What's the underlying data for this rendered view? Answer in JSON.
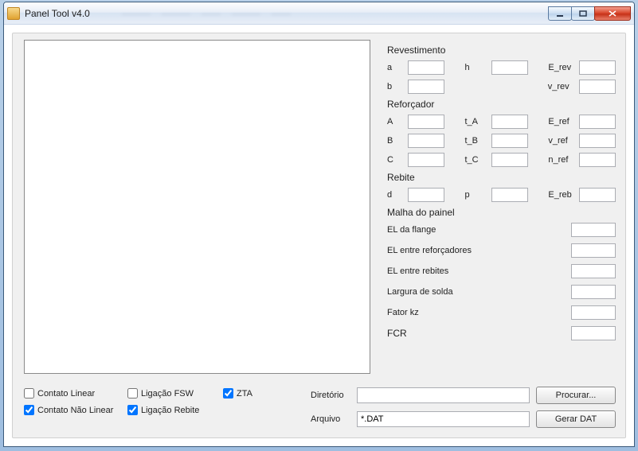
{
  "window": {
    "title": "Panel Tool v4.0"
  },
  "sections": {
    "revestimento": {
      "title": "Revestimento",
      "a_label": "a",
      "a": "",
      "b_label": "b",
      "b": "",
      "h_label": "h",
      "h": "",
      "E_rev_label": "E_rev",
      "E_rev": "",
      "v_rev_label": "v_rev",
      "v_rev": ""
    },
    "reforcador": {
      "title": "Reforçador",
      "A_label": "A",
      "A": "",
      "B_label": "B",
      "B": "",
      "C_label": "C",
      "C": "",
      "tA_label": "t_A",
      "tA": "",
      "tB_label": "t_B",
      "tB": "",
      "tC_label": "t_C",
      "tC": "",
      "E_ref_label": "E_ref",
      "E_ref": "",
      "v_ref_label": "v_ref",
      "v_ref": "",
      "n_ref_label": "n_ref",
      "n_ref": ""
    },
    "rebite": {
      "title": "Rebite",
      "d_label": "d",
      "d": "",
      "p_label": "p",
      "p": "",
      "E_reb_label": "E_reb",
      "E_reb": ""
    },
    "malha": {
      "title": "Malha do painel",
      "el_flange_label": "EL da flange",
      "el_flange": "",
      "el_reforcadores_label": "EL entre reforçadores",
      "el_reforcadores": "",
      "el_rebites_label": "EL entre rebites",
      "el_rebites": "",
      "largura_solda_label": "Largura de solda",
      "largura_solda": "",
      "fator_kz_label": "Fator kz",
      "fator_kz": "",
      "fcr_label": "FCR",
      "fcr": ""
    }
  },
  "checks": {
    "contato_linear_label": "Contato Linear",
    "contato_nao_linear_label": "Contato Não Linear",
    "ligacao_fsw_label": "Ligação FSW",
    "ligacao_rebite_label": "Ligação Rebite",
    "zta_label": "ZTA"
  },
  "file": {
    "diretorio_label": "Diretório",
    "diretorio": "",
    "arquivo_label": "Arquivo",
    "arquivo": "*.DAT",
    "procurar_label": "Procurar...",
    "gerar_label": "Gerar DAT"
  }
}
